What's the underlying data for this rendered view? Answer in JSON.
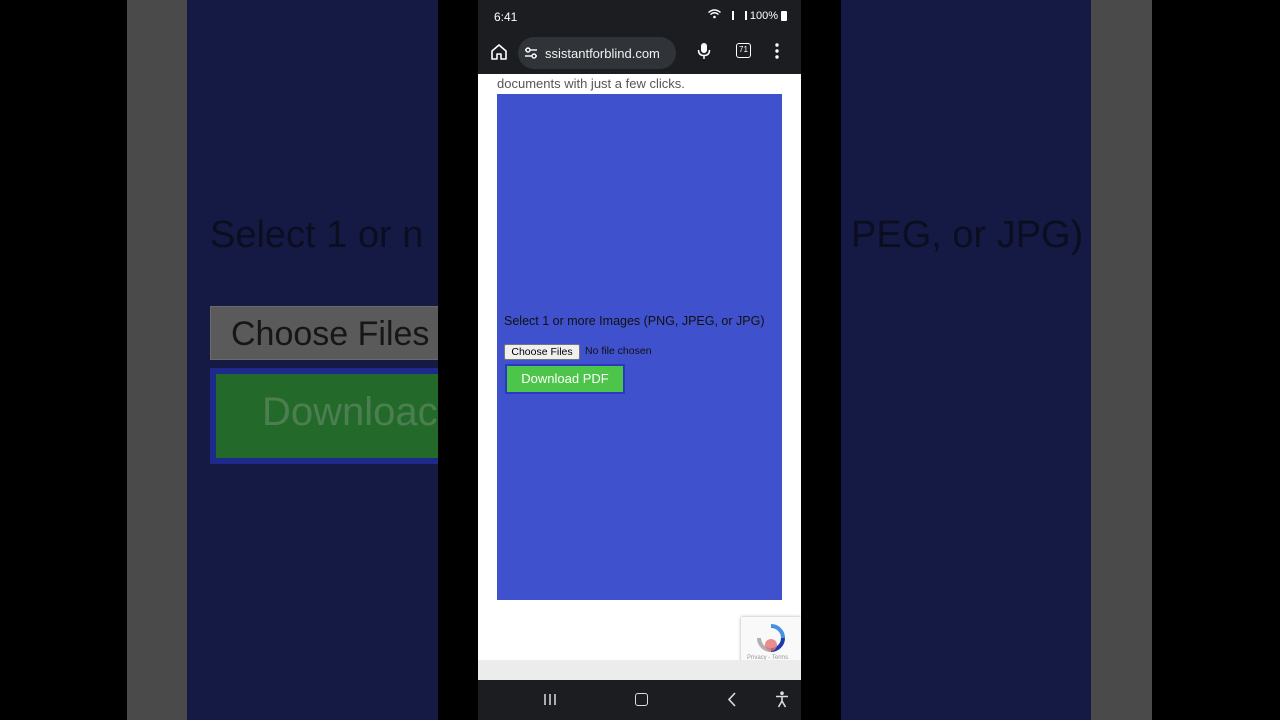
{
  "status_bar": {
    "time": "6:41",
    "battery": "100%"
  },
  "browser": {
    "url": "ssistantforblind.com",
    "tab_count": "71"
  },
  "page": {
    "intro_text": "documents with just a few clicks.",
    "upload_label": "Select 1 or more Images (PNG, JPEG, or JPG)",
    "choose_files_label": "Choose Files",
    "file_status": "No file chosen",
    "download_label": "Download PDF",
    "recaptcha_text": "Privacy - Terms"
  },
  "background": {
    "zoomed_label_left": "Select 1 or n",
    "zoomed_label_right": "PEG, or JPG)",
    "zoomed_choose": "Choose Files",
    "zoomed_download": "Downloac"
  },
  "colors": {
    "panel": "#3f51cc",
    "download_button": "#4cc54a",
    "browser_chrome": "#1b1d20"
  }
}
